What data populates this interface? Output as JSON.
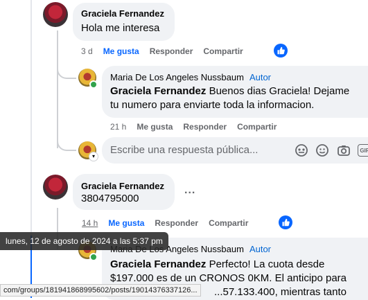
{
  "comments": [
    {
      "author": "Graciela Fernandez",
      "text": "Hola me interesa",
      "time": "3 d",
      "like": "Me gusta",
      "reply": "Responder",
      "share": "Compartir"
    },
    {
      "author": "Maria De Los Angeles Nussbaum",
      "tag": "Autor",
      "mention": "Graciela Fernandez",
      "text": " Buenos dias Graciela! Dejame tu numero para enviarte toda la informacion.",
      "time": "21 h",
      "like": "Me gusta",
      "reply": "Responder",
      "share": "Compartir"
    },
    {
      "author": "Graciela Fernandez",
      "text": "3804795000",
      "time": "14 h",
      "like": "Me gusta",
      "reply": "Responder",
      "share": "Compartir",
      "more": "..."
    },
    {
      "author": "Maria De Los Angeles Nussbaum",
      "tag": "Autor",
      "mention": "Graciela Fernandez",
      "text_line1": " Perfecto! La cuota desde",
      "text_line2": "$197.000 es de un CRONOS 0KM. El anticipo para",
      "text_line3": "...57.133.400, mientras tanto"
    }
  ],
  "reply_box": {
    "placeholder": "Escribe una respuesta pública..."
  },
  "tooltip": "lunes, 12 de agosto de 2024 a las 5:37 pm",
  "status_url": "com/groups/181941868995602/posts/19014376337126...",
  "colors": {
    "accent": "#0866ff",
    "author_tag": "#0064d1",
    "bubble": "#f0f2f5",
    "muted": "#65676b"
  }
}
